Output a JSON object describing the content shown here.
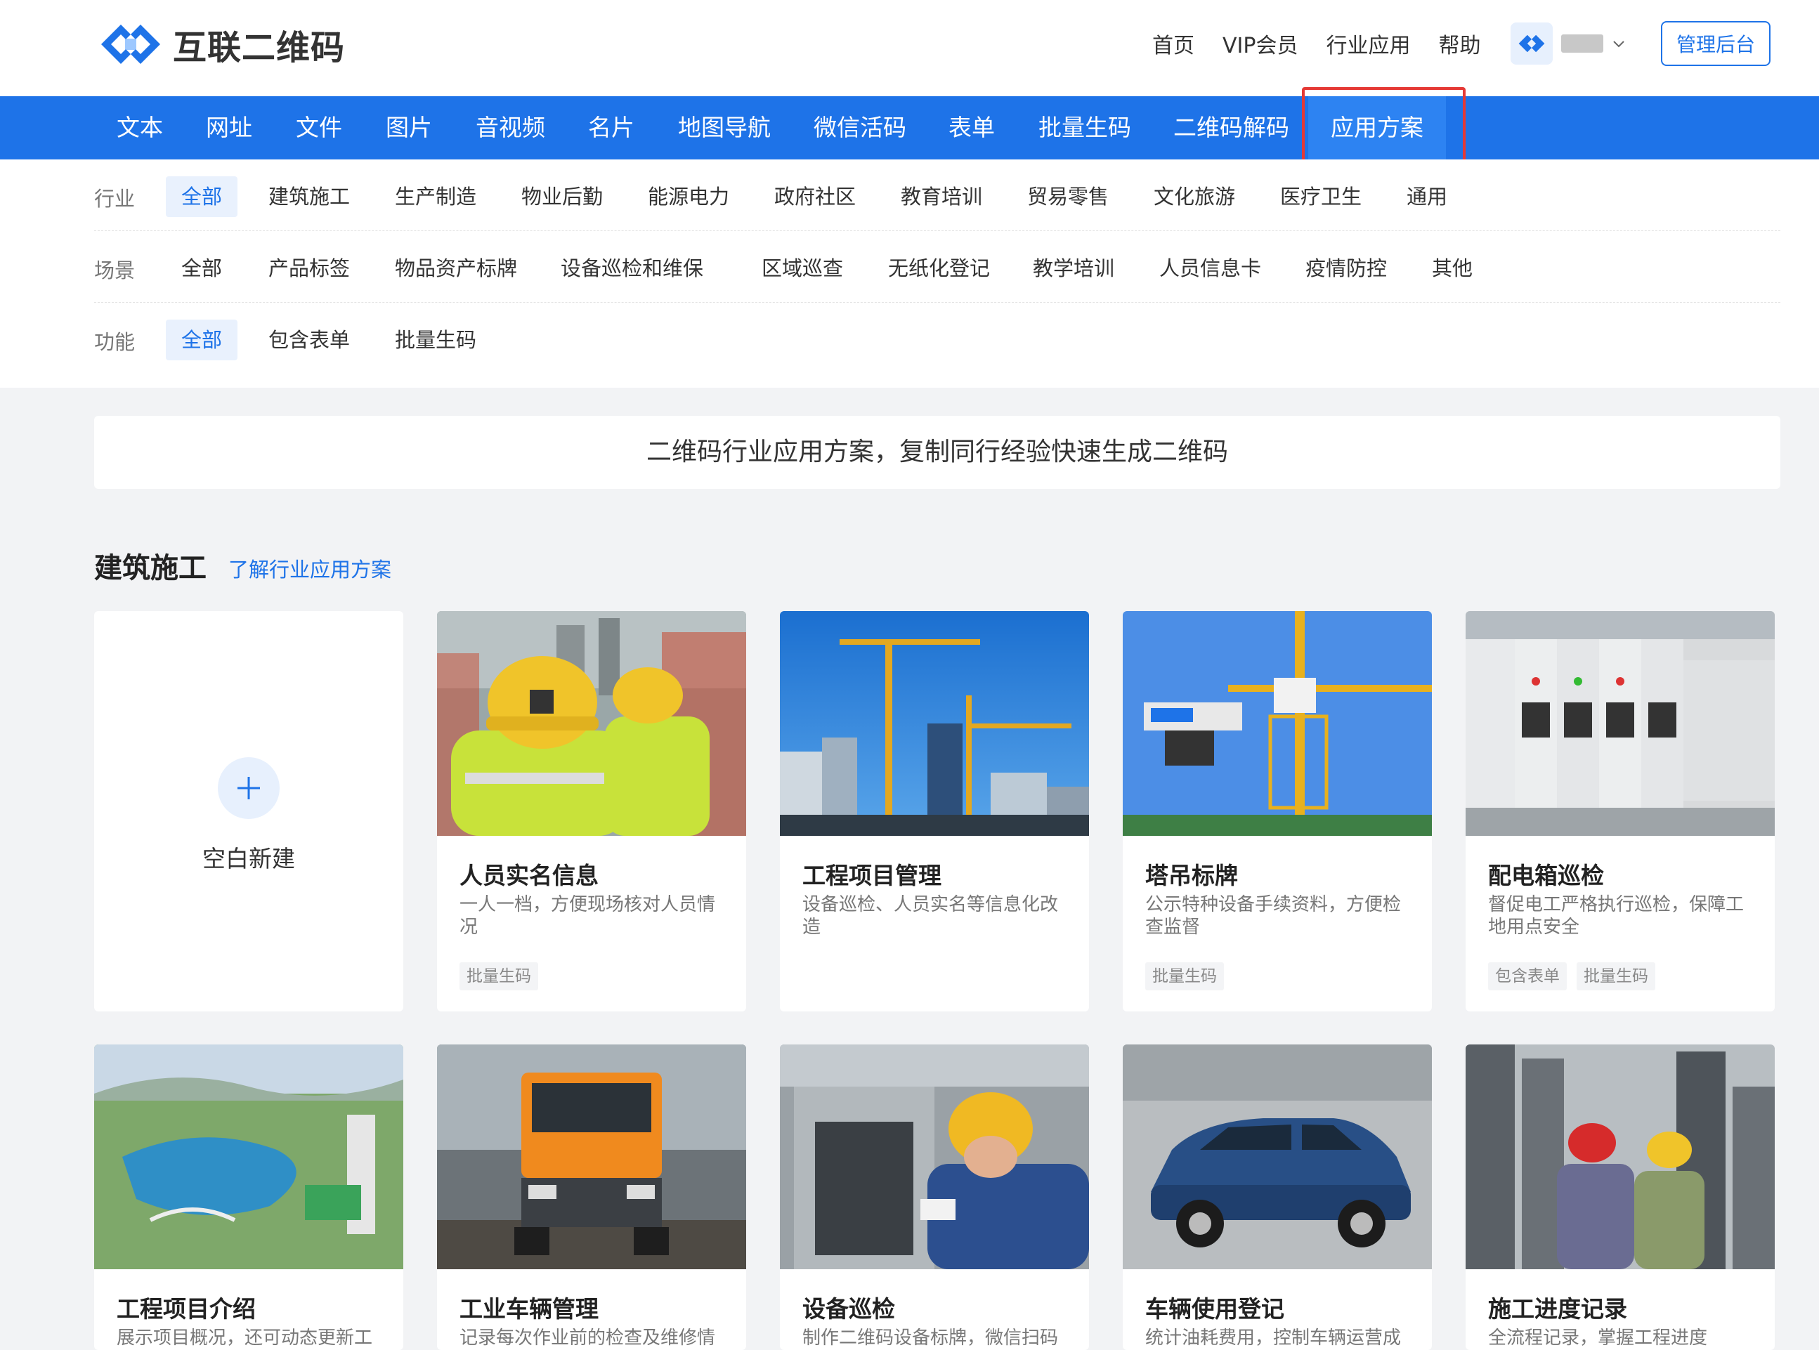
{
  "header": {
    "logo_text": "互联二维码",
    "top_nav": [
      "首页",
      "VIP会员",
      "行业应用",
      "帮助"
    ],
    "admin_button": "管理后台",
    "accent_color": "#1e73e8"
  },
  "main_nav": {
    "items": [
      "文本",
      "网址",
      "文件",
      "图片",
      "音视频",
      "名片",
      "地图导航",
      "微信活码",
      "表单",
      "批量生码",
      "二维码解码",
      "应用方案"
    ],
    "active": "应用方案"
  },
  "filters": {
    "industry": {
      "label": "行业",
      "options": [
        "全部",
        "建筑施工",
        "生产制造",
        "物业后勤",
        "能源电力",
        "政府社区",
        "教育培训",
        "贸易零售",
        "文化旅游",
        "医疗卫生",
        "通用"
      ]
    },
    "scene": {
      "label": "场景",
      "options": [
        "全部",
        "产品标签",
        "物品资产标牌",
        "设备巡检和维保",
        "区域巡查",
        "无纸化登记",
        "教学培训",
        "人员信息卡",
        "疫情防控",
        "其他"
      ]
    },
    "feature": {
      "label": "功能",
      "options": [
        "全部",
        "包含表单",
        "批量生码"
      ]
    }
  },
  "banner": {
    "text": "二维码行业应用方案，复制同行经验快速生成二维码"
  },
  "section": {
    "title": "建筑施工",
    "link": "了解行业应用方案",
    "blank_card_label": "空白新建",
    "cards": [
      {
        "title": "人员实名信息",
        "desc": "一人一档，方便现场核对人员情况",
        "tags": [
          "批量生码"
        ],
        "icon": "worker-helmet-photo"
      },
      {
        "title": "工程项目管理",
        "desc": "设备巡检、人员实名等信息化改造",
        "tags": [],
        "icon": "tower-crane-city-photo"
      },
      {
        "title": "塔吊标牌",
        "desc": "公示特种设备手续资料，方便检查监督",
        "tags": [
          "批量生码"
        ],
        "icon": "tower-crane-photo"
      },
      {
        "title": "配电箱巡检",
        "desc": "督促电工严格执行巡检，保障工地用点安全",
        "tags": [
          "包含表单",
          "批量生码"
        ],
        "icon": "electrical-cabinet-photo"
      },
      {
        "title": "工程项目介绍",
        "desc": "展示项目概况，还可动态更新工",
        "tags": [],
        "icon": "aerial-city-photo"
      },
      {
        "title": "工业车辆管理",
        "desc": "记录每次作业前的检查及维修情",
        "tags": [],
        "icon": "truck-photo"
      },
      {
        "title": "设备巡检",
        "desc": "制作二维码设备标牌，微信扫码",
        "tags": [],
        "icon": "technician-photo"
      },
      {
        "title": "车辆使用登记",
        "desc": "统计油耗费用，控制车辆运营成",
        "tags": [],
        "icon": "suv-car-photo"
      },
      {
        "title": "施工进度记录",
        "desc": "全流程记录，掌握工程进度",
        "tags": [],
        "icon": "construction-workers-photo"
      }
    ]
  }
}
